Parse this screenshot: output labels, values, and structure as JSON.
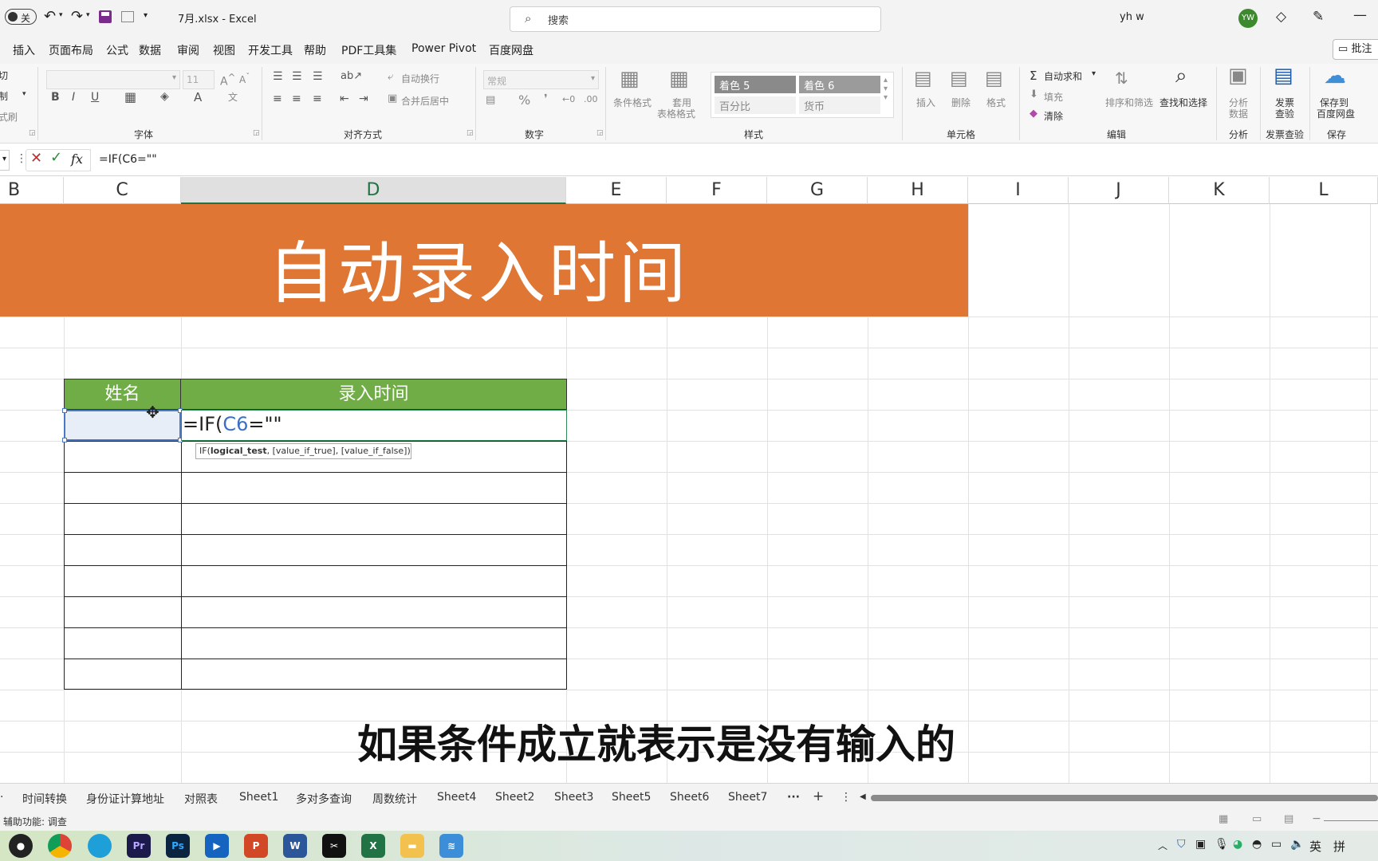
{
  "titlebar": {
    "autosave_label": "关",
    "file_title": "7月.xlsx  -  Excel",
    "search_placeholder": "搜索",
    "user_name": "yh w",
    "user_initials": "YW"
  },
  "menu": {
    "items": [
      "插入",
      "页面布局",
      "公式",
      "数据",
      "审阅",
      "视图",
      "开发工具",
      "帮助",
      "PDF工具集",
      "Power Pivot",
      "百度网盘"
    ],
    "comments_label": "批注"
  },
  "ribbon": {
    "clipboard": {
      "cut": "剪切",
      "copy": "复制",
      "format_painter": "格式刷"
    },
    "font": {
      "size": "11",
      "group_label": "字体"
    },
    "align": {
      "wrap": "自动换行",
      "merge": "合并后居中",
      "group_label": "对齐方式"
    },
    "number": {
      "format": "常规",
      "group_label": "数字"
    },
    "styles": {
      "conditional": "条件格式",
      "table_format_1": "套用",
      "table_format_2": "表格格式",
      "style_1": "着色 5",
      "style_2": "着色 6",
      "style_3": "百分比",
      "style_4": "货币",
      "group_label": "样式"
    },
    "cells": {
      "insert": "插入",
      "delete": "删除",
      "format": "格式",
      "group_label": "单元格"
    },
    "editing": {
      "autosum": "自动求和",
      "fill": "填充",
      "clear": "清除",
      "sort": "排序和筛选",
      "find": "查找和选择",
      "group_label": "编辑"
    },
    "analysis": {
      "button_1": "分析",
      "button_2": "数据",
      "group_label": "分析"
    },
    "invoice": {
      "button_1": "发票",
      "button_2": "查验",
      "group_label": "发票查验"
    },
    "save": {
      "button_1": "保存到",
      "button_2": "百度网盘",
      "group_label": "保存"
    }
  },
  "formula_bar": {
    "fx": "fx",
    "content": "=IF(C6=\"\""
  },
  "columns": [
    "B",
    "C",
    "D",
    "E",
    "F",
    "G",
    "H",
    "I",
    "J",
    "K",
    "L"
  ],
  "sheet": {
    "banner_title": "自动录入时间",
    "header_name": "姓名",
    "header_time": "录入时间",
    "edit_prefix": "=IF(",
    "edit_ref": "C6",
    "edit_suffix": "=\"\"",
    "tooltip_fn": "IF(",
    "tooltip_arg1": "logical_test",
    "tooltip_rest": ", [value_if_true], [value_if_false])",
    "subtitle": "如果条件成立就表示是没有输入的"
  },
  "sheet_tabs": [
    "时间转换",
    "身份证计算地址",
    "对照表",
    "Sheet1",
    "多对多查询",
    "周数统计",
    "Sheet4",
    "Sheet2",
    "Sheet3",
    "Sheet5",
    "Sheet6",
    "Sheet7"
  ],
  "status": {
    "accessibility": "辅助功能: 调查"
  },
  "taskbar": {
    "ime": "英",
    "ime2": "拼"
  },
  "colors": {
    "banner": "#e07634",
    "header_green": "#70ad47",
    "accent_excel": "#217346"
  }
}
